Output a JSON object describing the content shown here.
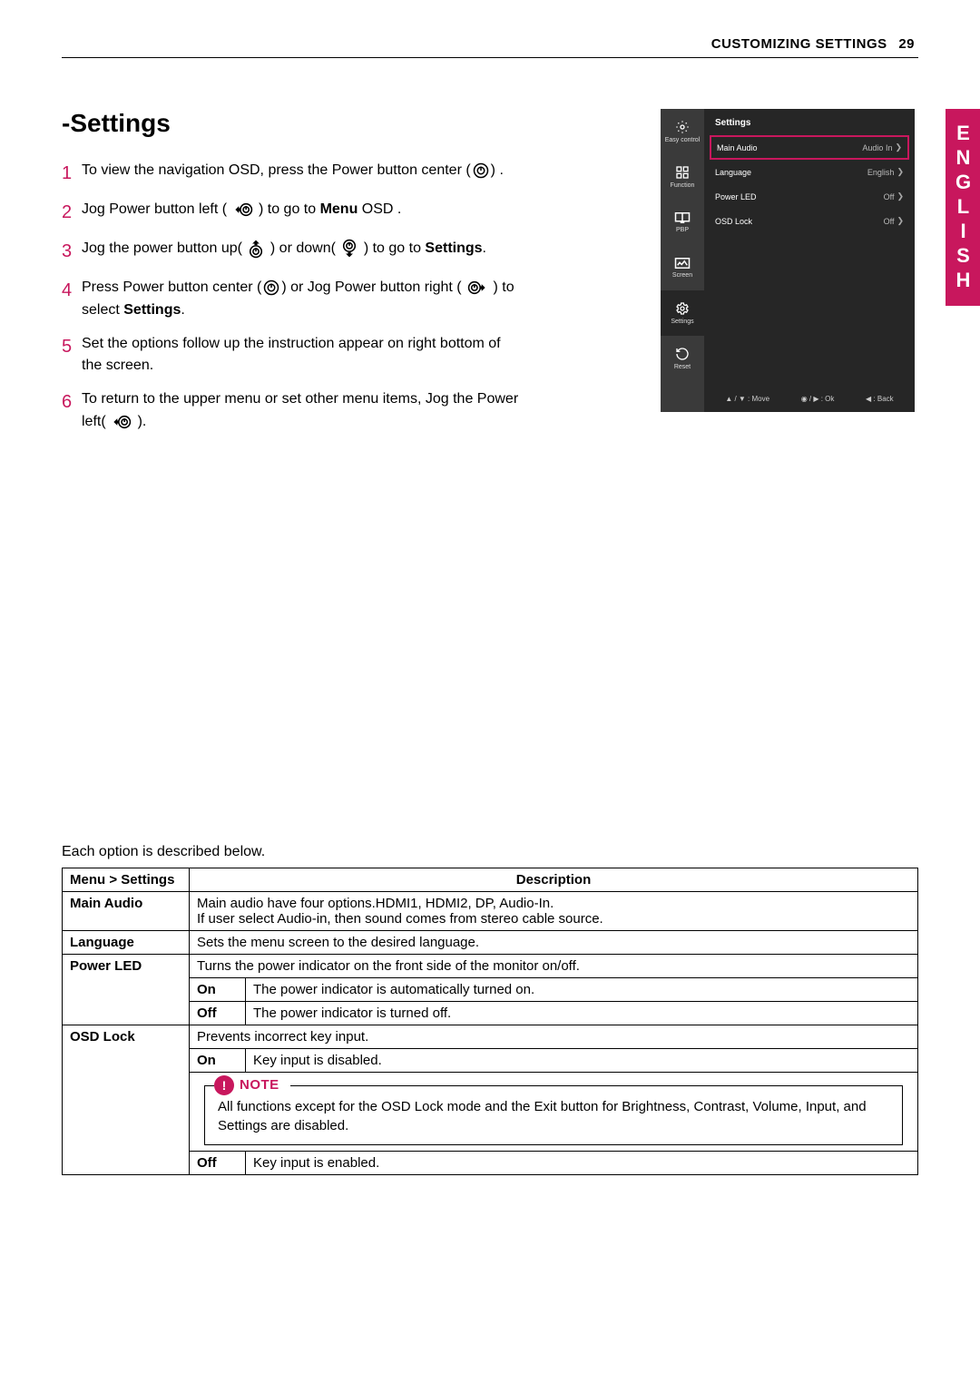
{
  "header": {
    "section": "CUSTOMIZING SETTINGS",
    "page": "29"
  },
  "side_tab": "ENGLISH",
  "title": "-Settings",
  "steps": [
    {
      "num": "1",
      "pre": "To view the navigation OSD, press the Power button center (",
      "post": ") ."
    },
    {
      "num": "2",
      "pre": "Jog Power button left ( ",
      "mid1": " ) to go to ",
      "bold1": "Menu",
      "post": " OSD ."
    },
    {
      "num": "3",
      "pre": "Jog the power button up(  ",
      "mid1": "  ) or down(  ",
      "mid2": "  ) to go to ",
      "bold1": "Settings",
      "post": "."
    },
    {
      "num": "4",
      "pre": "Press Power button center (",
      "mid1": ") or Jog Power button right ( ",
      "mid2": " ) to select ",
      "bold1": "Settings",
      "post": "."
    },
    {
      "num": "5",
      "text": "Set the options follow up the instruction appear on right bottom of the screen."
    },
    {
      "num": "6",
      "pre": "To return to the upper menu or set other menu items, Jog the Power left( ",
      "post": "  )."
    }
  ],
  "osd": {
    "title": "Settings",
    "sidebar": [
      {
        "label": "Easy control"
      },
      {
        "label": "Function"
      },
      {
        "label": "PBP"
      },
      {
        "label": "Screen"
      },
      {
        "label": "Settings"
      },
      {
        "label": "Reset"
      }
    ],
    "rows": [
      {
        "label": "Main Audio",
        "value": "Audio In",
        "selected": true
      },
      {
        "label": "Language",
        "value": "English"
      },
      {
        "label": "Power LED",
        "value": "Off"
      },
      {
        "label": "OSD Lock",
        "value": "Off"
      }
    ],
    "footer": {
      "move": "▲ / ▼ : Move",
      "ok": "◉ / ▶  : Ok",
      "back": "◀  : Back"
    }
  },
  "each_desc": "Each option is described below.",
  "table": {
    "head_menu": "Menu > Settings",
    "head_desc": "Description",
    "main_audio_label": "Main Audio",
    "main_audio_desc": "Main audio have four options.HDMI1, HDMI2, DP, Audio-In.\nIf user select Audio-in, then sound comes from stereo cable source.",
    "language_label": "Language",
    "language_desc": "Sets the menu screen to the desired language.",
    "powerled_label": "Power LED",
    "powerled_desc": "Turns the power indicator on the front side of the monitor on/off.",
    "powerled_on": "On",
    "powerled_on_desc": "The power indicator is automatically turned on.",
    "powerled_off": "Off",
    "powerled_off_desc": "The power indicator is turned off.",
    "osdlock_label": "OSD Lock",
    "osdlock_desc": "Prevents incorrect key input.",
    "osdlock_on": "On",
    "osdlock_on_desc": "Key input is disabled.",
    "note_label": "NOTE",
    "note_text": "All functions except for the OSD Lock mode and the Exit button for Brightness, Contrast, Volume, Input, and Settings are disabled.",
    "osdlock_off": "Off",
    "osdlock_off_desc": "Key input is enabled."
  }
}
